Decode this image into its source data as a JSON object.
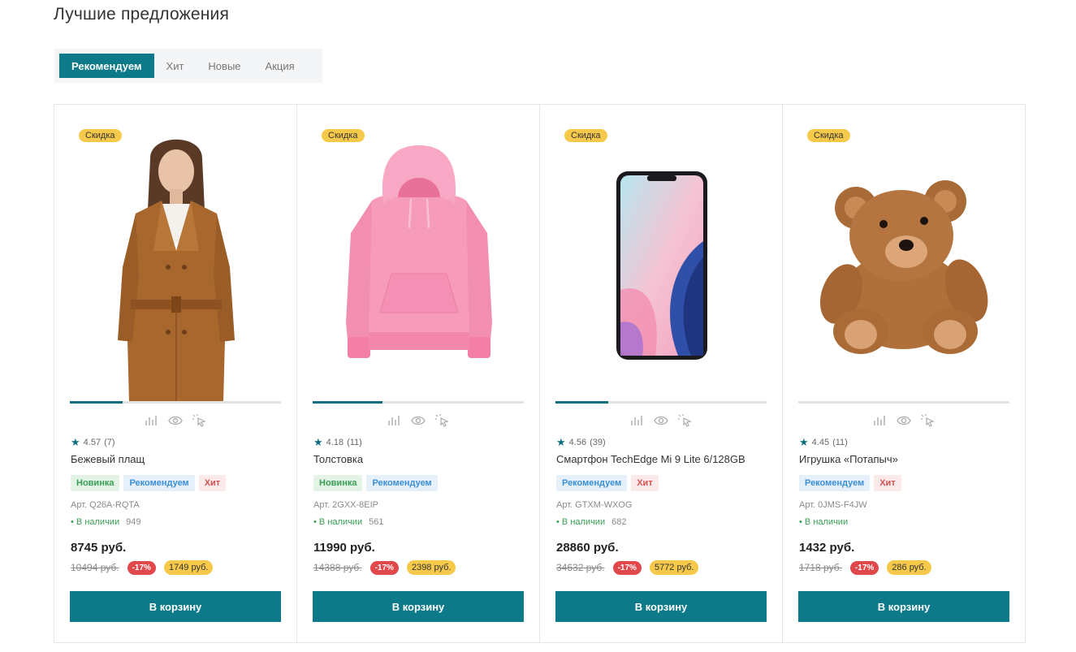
{
  "title": "Лучшие предложения",
  "tabs": [
    {
      "label": "Рекомендуем",
      "active": true
    },
    {
      "label": "Хит",
      "active": false
    },
    {
      "label": "Новые",
      "active": false
    },
    {
      "label": "Акция",
      "active": false
    }
  ],
  "colors": {
    "accent": "#0d7a8a",
    "sale_badge": "#f6c94a",
    "discount": "#e0484b"
  },
  "icons": [
    "compare-icon",
    "quick-view-icon",
    "buy-one-click-icon",
    "star-icon"
  ],
  "products": [
    {
      "badge": "Скидка",
      "image": "beige-trench-coat",
      "gallery_position": 0.25,
      "rating": "4.57",
      "reviews": "(7)",
      "name": "Бежевый плащ",
      "tags": [
        {
          "text": "Новинка",
          "type": "new"
        },
        {
          "text": "Рекомендуем",
          "type": "rec"
        },
        {
          "text": "Хит",
          "type": "hit"
        }
      ],
      "sku": "Арт. Q26A-RQTA",
      "stock_label": "В наличии",
      "stock_count": "949",
      "price": "8745 руб.",
      "old_price": "10494 руб.",
      "discount": "-17%",
      "saving": "1749 руб.",
      "button": "В корзину"
    },
    {
      "badge": "Скидка",
      "image": "pink-hoodie",
      "gallery_position": 0.33,
      "rating": "4.18",
      "reviews": "(11)",
      "name": "Толстовка",
      "tags": [
        {
          "text": "Новинка",
          "type": "new"
        },
        {
          "text": "Рекомендуем",
          "type": "rec"
        }
      ],
      "sku": "Арт. 2GXX-8EIP",
      "stock_label": "В наличии",
      "stock_count": "561",
      "price": "11990 руб.",
      "old_price": "14388 руб.",
      "discount": "-17%",
      "saving": "2398 руб.",
      "button": "В корзину"
    },
    {
      "badge": "Скидка",
      "image": "smartphone",
      "gallery_position": 0.25,
      "rating": "4.56",
      "reviews": "(39)",
      "name": "Смартфон TechEdge Mi 9 Lite 6/128GB",
      "tags": [
        {
          "text": "Рекомендуем",
          "type": "rec"
        },
        {
          "text": "Хит",
          "type": "hit"
        }
      ],
      "sku": "Арт. GTXM-WXOG",
      "stock_label": "В наличии",
      "stock_count": "682",
      "price": "28860 руб.",
      "old_price": "34632 руб.",
      "discount": "-17%",
      "saving": "5772 руб.",
      "button": "В корзину"
    },
    {
      "badge": "Скидка",
      "image": "teddy-bear",
      "gallery_position": 0,
      "rating": "4.45",
      "reviews": "(11)",
      "name": "Игрушка «Потапыч»",
      "tags": [
        {
          "text": "Рекомендуем",
          "type": "rec"
        },
        {
          "text": "Хит",
          "type": "hit"
        }
      ],
      "sku": "Арт. 0JMS-F4JW",
      "stock_label": "В наличии",
      "stock_count": "",
      "price": "1432 руб.",
      "old_price": "1718 руб.",
      "discount": "-17%",
      "saving": "286 руб.",
      "button": "В корзину"
    }
  ]
}
